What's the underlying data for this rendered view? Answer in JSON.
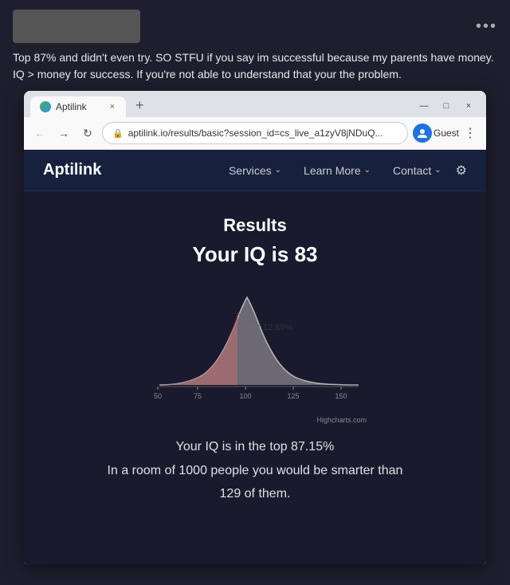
{
  "post": {
    "text": "Top 87% and didn't even try. SO STFU if you say im successful because my parents have money. IQ > money for success. If you're not able to understand that your the problem.",
    "dots": "•••"
  },
  "browser": {
    "tab_title": "Aptilink",
    "tab_close": "×",
    "tab_new": "+",
    "win_minimize": "—",
    "win_maximize": "□",
    "win_close": "×",
    "url": "aptilink.io/results/basic?session_id=cs_live_a1zyV8jNDuQ...",
    "profile_label": "Guest",
    "menu_icon": "⋮"
  },
  "site": {
    "logo": "Aptilink",
    "nav": {
      "services": "Services",
      "learn_more": "Learn More",
      "contact": "Contact"
    },
    "results": {
      "title": "Results",
      "iq_line": "Your IQ is 83",
      "percentage_label": "12.85%",
      "stat1": "Your IQ is in the top 87.15%",
      "stat2": "In a room of 1000 people you would be smarter than",
      "stat3": "129 of them.",
      "attribution": "Highcharts.com"
    }
  },
  "chart": {
    "x_labels": [
      "50",
      "75",
      "100",
      "125",
      "150"
    ],
    "accent_color": "#c0392b",
    "curve_color": "#ecf0f1"
  }
}
